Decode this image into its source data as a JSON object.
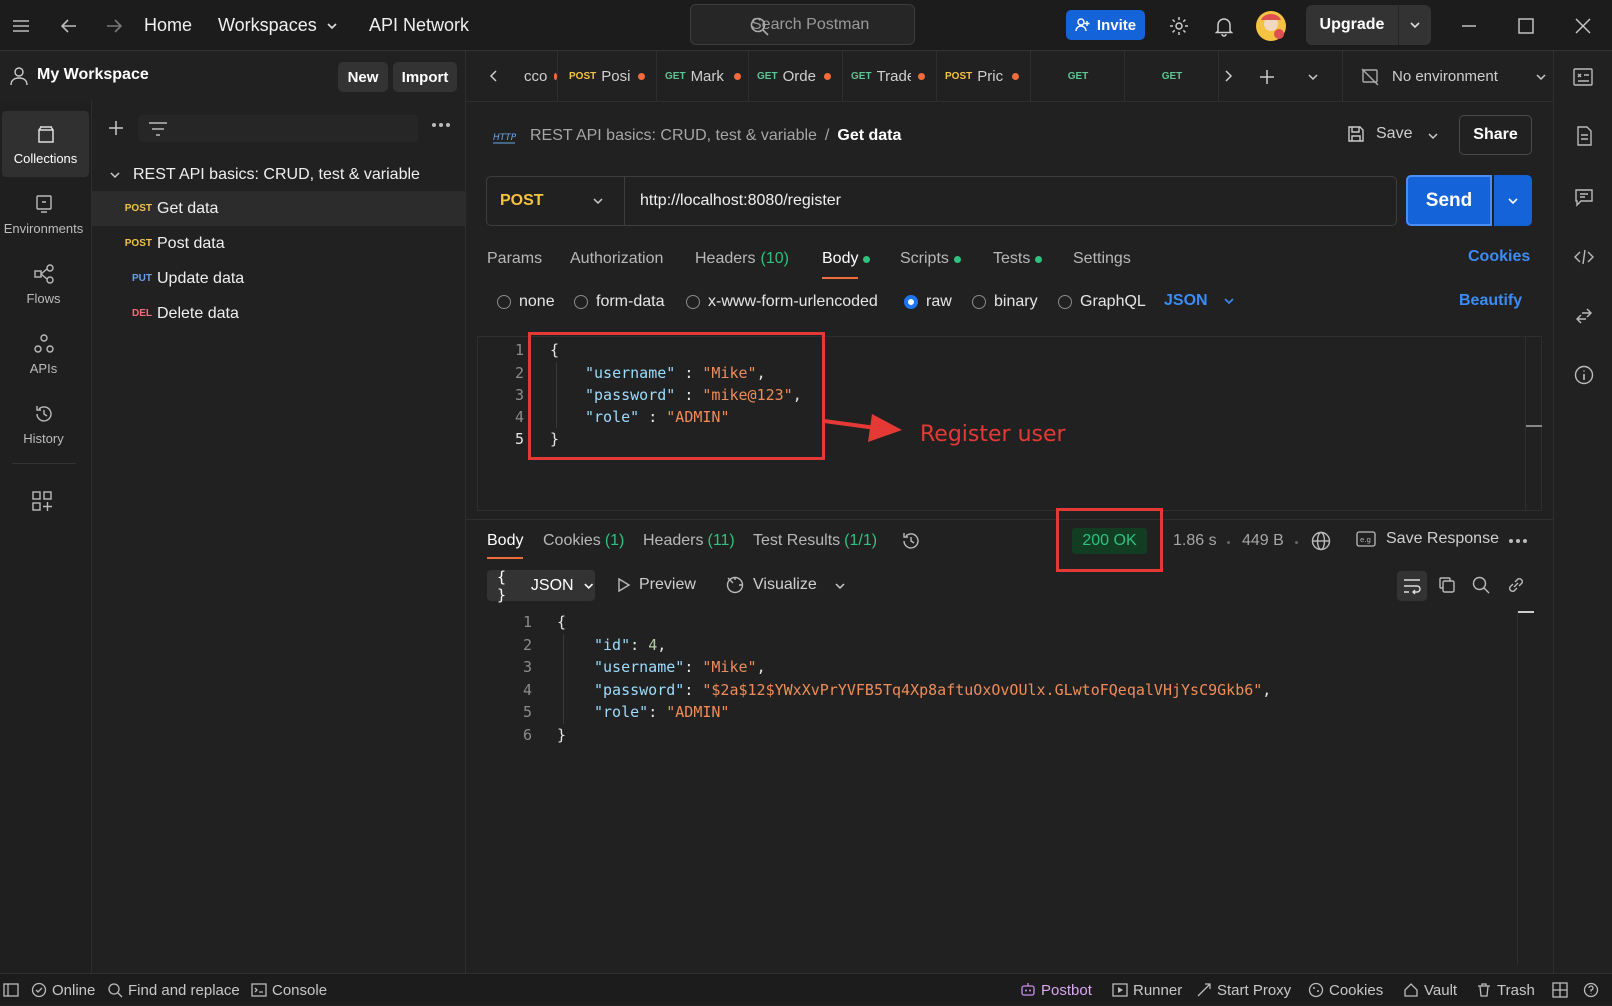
{
  "topbar": {
    "home": "Home",
    "workspaces": "Workspaces",
    "api_network": "API Network",
    "search_placeholder": "Search Postman",
    "invite": "Invite",
    "upgrade": "Upgrade"
  },
  "workspace": {
    "title": "My Workspace",
    "new_label": "New",
    "import_label": "Import"
  },
  "rail": [
    {
      "label": "Collections",
      "icon": "collections-icon"
    },
    {
      "label": "Environments",
      "icon": "environments-icon"
    },
    {
      "label": "Flows",
      "icon": "flows-icon"
    },
    {
      "label": "APIs",
      "icon": "apis-icon"
    },
    {
      "label": "History",
      "icon": "history-icon"
    }
  ],
  "collection": {
    "name": "REST API basics: CRUD, test & variable",
    "requests": [
      {
        "method": "POST",
        "name": "Get data"
      },
      {
        "method": "POST",
        "name": "Post data"
      },
      {
        "method": "PUT",
        "name": "Update data"
      },
      {
        "method": "DEL",
        "name": "Delete data"
      }
    ]
  },
  "tabs": [
    {
      "method": "",
      "name": "cco"
    },
    {
      "method": "POST",
      "name": "Posi"
    },
    {
      "method": "GET",
      "name": "Mark"
    },
    {
      "method": "GET",
      "name": "Orde"
    },
    {
      "method": "GET",
      "name": "Trade"
    },
    {
      "method": "POST",
      "name": "Pric"
    },
    {
      "method": "GET",
      "name": ""
    },
    {
      "method": "GET",
      "name": ""
    }
  ],
  "environment": "No environment",
  "breadcrumb": {
    "collection": "REST API basics: CRUD, test & variable",
    "separator": "/",
    "request": "Get data"
  },
  "actions": {
    "save": "Save",
    "share": "Share",
    "send": "Send"
  },
  "request": {
    "method": "POST",
    "url": "http://localhost:8080/register",
    "tabs": {
      "params": "Params",
      "authorization": "Authorization",
      "headers": "Headers",
      "headers_count": "(10)",
      "body": "Body",
      "scripts": "Scripts",
      "tests": "Tests",
      "settings": "Settings"
    },
    "cookies": "Cookies",
    "body_types": [
      "none",
      "form-data",
      "x-www-form-urlencoded",
      "raw",
      "binary",
      "GraphQL"
    ],
    "selected_body_type": "raw",
    "language": "JSON",
    "beautify": "Beautify",
    "body_lines": [
      "{",
      "\"username\" : \"Mike\",",
      "\"password\" : \"mike@123\",",
      "\"role\" : \"ADMIN\"",
      "}"
    ]
  },
  "annotation": {
    "text": "Register user",
    "color": "#e53935"
  },
  "response": {
    "tabs": {
      "body": "Body",
      "cookies": "Cookies",
      "cookies_count": "(1)",
      "headers": "Headers",
      "headers_count": "(11)",
      "test_results": "Test Results",
      "test_results_count": "(1/1)"
    },
    "status": "200 OK",
    "time": "1.86 s",
    "size": "449 B",
    "save_response": "Save Response",
    "format": "JSON",
    "preview": "Preview",
    "visualize": "Visualize",
    "body": {
      "id": "4",
      "username": "\"Mike\"",
      "password": "\"$2a$12$YWxXvPrYVFB5Tq4Xp8aftuOxOvOUlx.GLwtoFQeqalVHjYsC9Gkb6\"",
      "role": "\"ADMIN\""
    }
  },
  "statusbar": {
    "online": "Online",
    "find_replace": "Find and replace",
    "console": "Console",
    "postbot": "Postbot",
    "runner": "Runner",
    "start_proxy": "Start Proxy",
    "cookies": "Cookies",
    "vault": "Vault",
    "trash": "Trash"
  },
  "colors": {
    "accent": "#1463d9",
    "post": "#f5c342",
    "get": "#5ec491",
    "put": "#6a9ff0",
    "del": "#f07178",
    "success": "#2ec27e",
    "tab_indicator": "#f26b3a"
  }
}
